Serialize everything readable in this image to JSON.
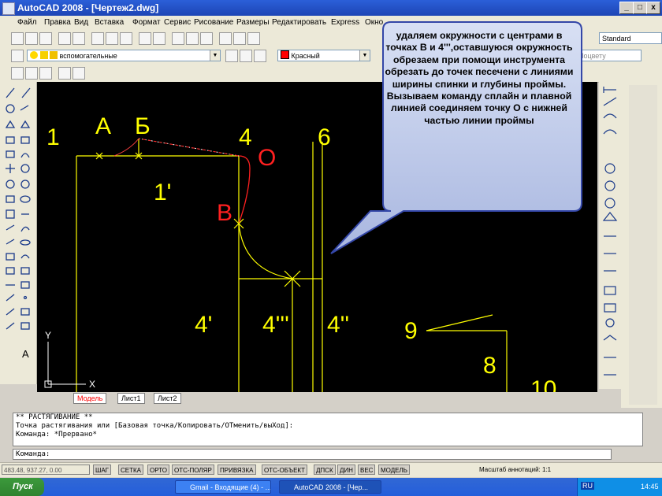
{
  "window": {
    "title": "AutoCAD 2008 - [Чертеж2.dwg]",
    "min": "_",
    "max": "□",
    "close": "x"
  },
  "menu": [
    "Файл",
    "Правка",
    "Вид",
    "Вставка",
    "Формат",
    "Сервис",
    "Рисование",
    "Размеры",
    "Редактировать",
    "Express",
    "Окно"
  ],
  "toolbar": {
    "layer_name": "вспомогательные",
    "color_name": "Красный",
    "style": "Standard",
    "linetype": "Поцвету"
  },
  "callout": {
    "text": "удаляем окружности с центрами в точках В и 4''',оставшуюся окружность обрезаем при помощи инструмента обрезать до точек песечени с линиями ширины спинки и глубины проймы. Вызываем команду сплайн и плавной линией соединяем точку О с нижней частью линии проймы"
  },
  "drawing": {
    "labels": {
      "one": "1",
      "a": "А",
      "b_top": "Б",
      "four_top": "4",
      "six": "6",
      "o": "О",
      "one_prime": "1'",
      "b_red": "В",
      "four_prime": "4'",
      "four_tpp": "4'''",
      "four_dp": "4''",
      "nine": "9",
      "eight": "8",
      "ten": "10",
      "axis_y": "Y",
      "axis_x": "X"
    },
    "colors": {
      "yellow": "#ffff00",
      "red": "#ff2020",
      "white": "#ffffff"
    }
  },
  "layout_tabs": {
    "model": "Модель",
    "sheet1": "Лист1",
    "sheet2": "Лист2"
  },
  "command": {
    "history": [
      "** РАСТЯГИВАНИЕ **",
      "Точка растягивания или [Базовая точка/Копировать/ОТменить/выХод]:",
      "Команда: *Прервано*"
    ],
    "prompt": "Команда:"
  },
  "status": {
    "coords": "483.48, 937.27, 0.00",
    "buttons": [
      "ШАГ",
      "СЕТКА",
      "ОРТО",
      "ОТС-ПОЛЯР",
      "ПРИВЯЗКА",
      "ОТС-ОБЪЕКТ",
      "ДПСК",
      "ДИН",
      "ВЕС",
      "МОДЕЛЬ"
    ],
    "annot_scale": "Масштаб аннотаций: 1:1"
  },
  "taskbar": {
    "start": "Пуск",
    "items": [
      "Gmail - Входящие (4) - ...",
      "AutoCAD 2008 - [Чер..."
    ],
    "lang": "RU",
    "time": "14:45"
  }
}
